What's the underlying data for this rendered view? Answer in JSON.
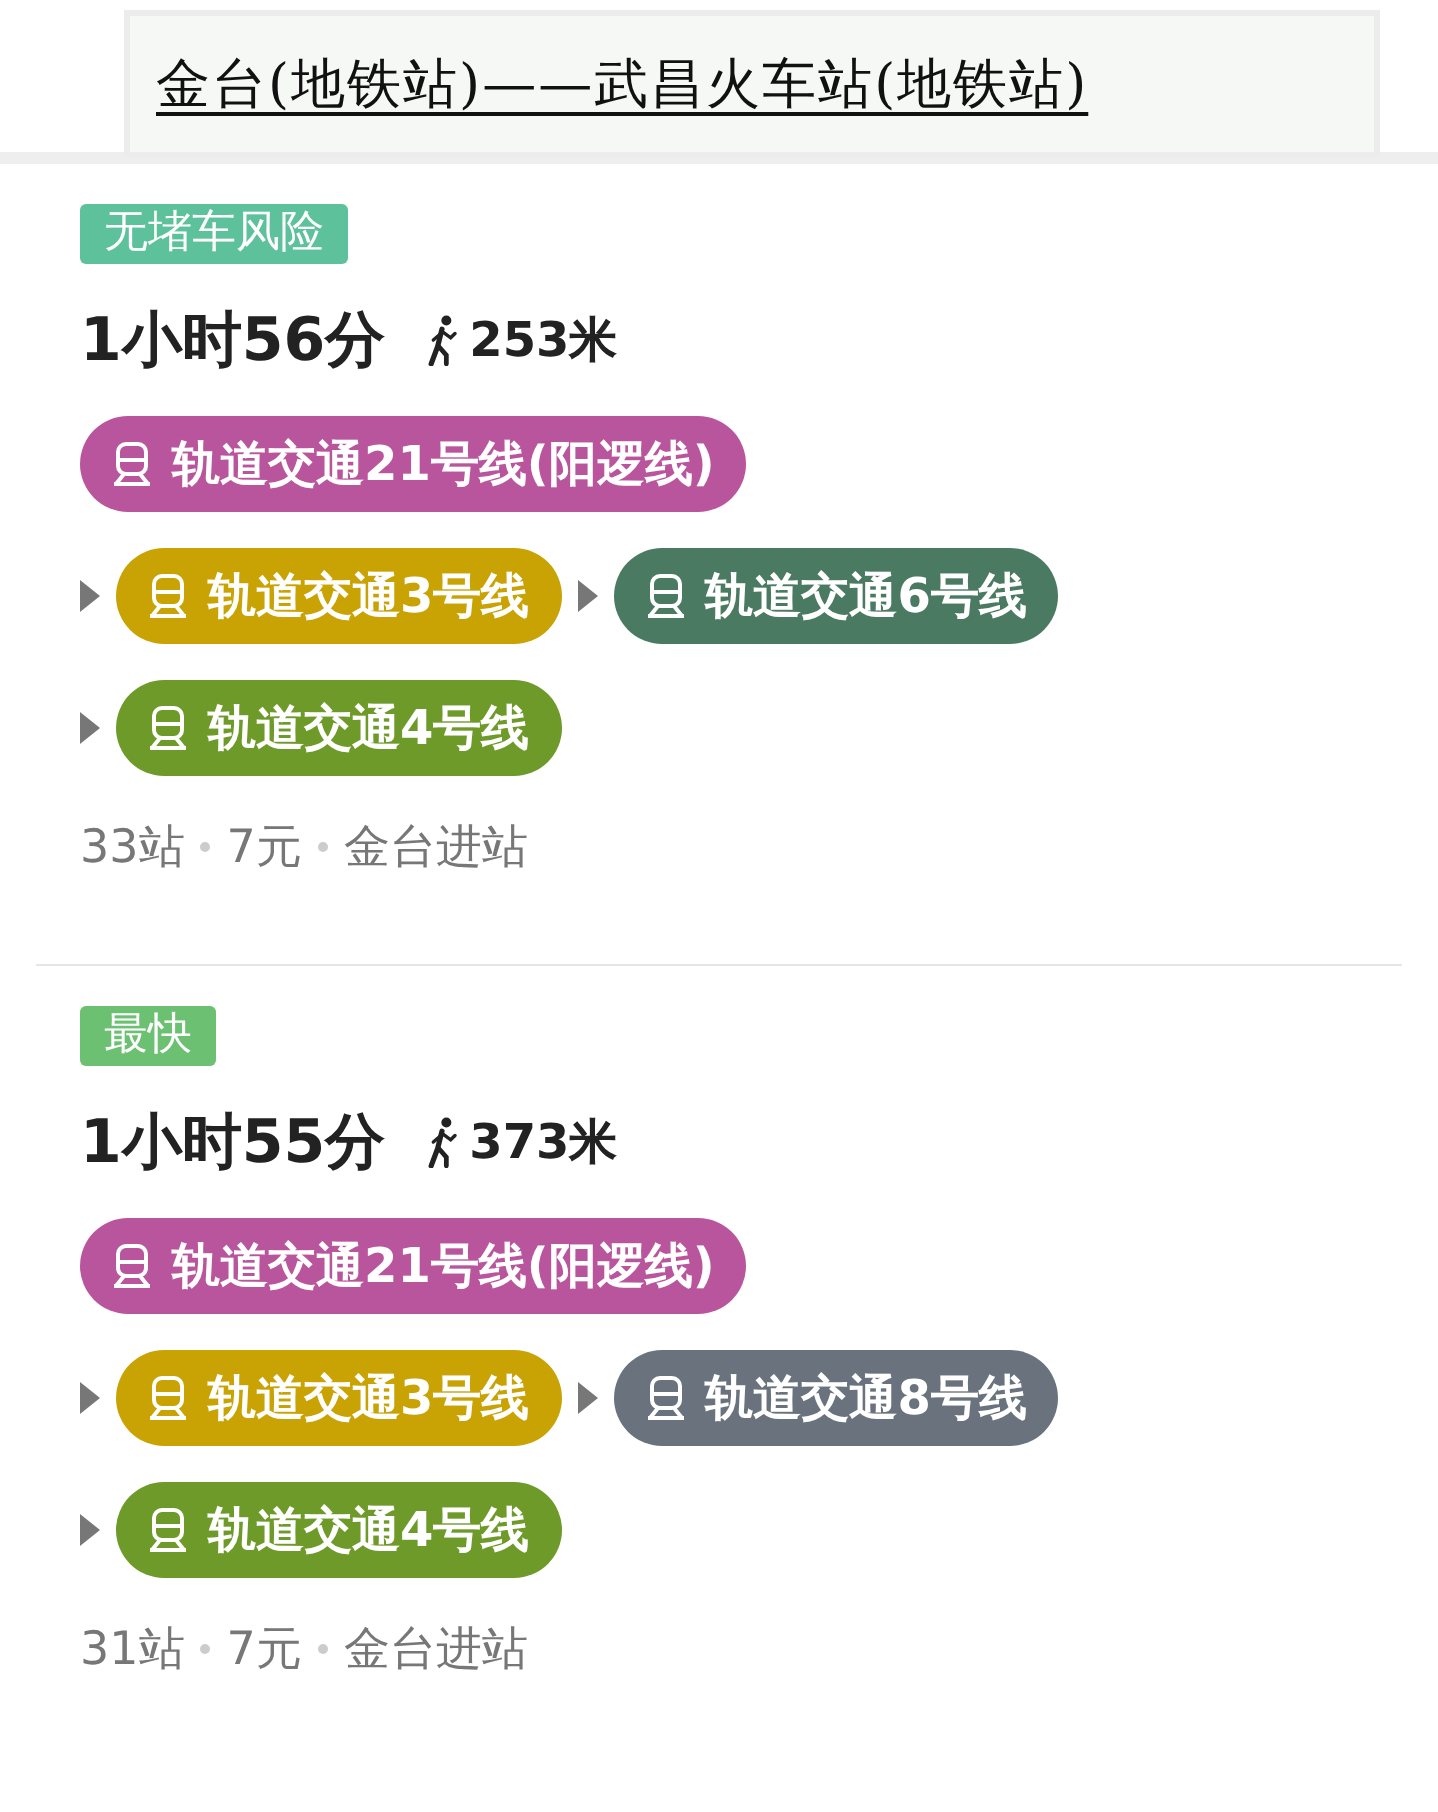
{
  "header": {
    "title": "金台(地铁站)——武昌火车站(地铁站)"
  },
  "routes": [
    {
      "tag": {
        "label": "无堵车风险",
        "color": "#5dc29b"
      },
      "duration": "1小时56分",
      "walk": "253米",
      "line_rows": [
        [
          {
            "name": "轨道交通21号线(阳逻线)",
            "color": "#b9559d"
          }
        ],
        [
          {
            "name": "轨道交通3号线",
            "color": "#c9a203"
          },
          {
            "name": "轨道交通6号线",
            "color": "#4b7a63"
          }
        ],
        [
          {
            "name": "轨道交通4号线",
            "color": "#6e9a29"
          }
        ]
      ],
      "meta": [
        "33站",
        "7元",
        "金台进站"
      ]
    },
    {
      "tag": {
        "label": "最快",
        "color": "#6bc072"
      },
      "duration": "1小时55分",
      "walk": "373米",
      "line_rows": [
        [
          {
            "name": "轨道交通21号线(阳逻线)",
            "color": "#b9559d"
          }
        ],
        [
          {
            "name": "轨道交通3号线",
            "color": "#c9a203"
          },
          {
            "name": "轨道交通8号线",
            "color": "#6a737d"
          }
        ],
        [
          {
            "name": "轨道交通4号线",
            "color": "#6e9a29"
          }
        ]
      ],
      "meta": [
        "31站",
        "7元",
        "金台进站"
      ]
    }
  ]
}
